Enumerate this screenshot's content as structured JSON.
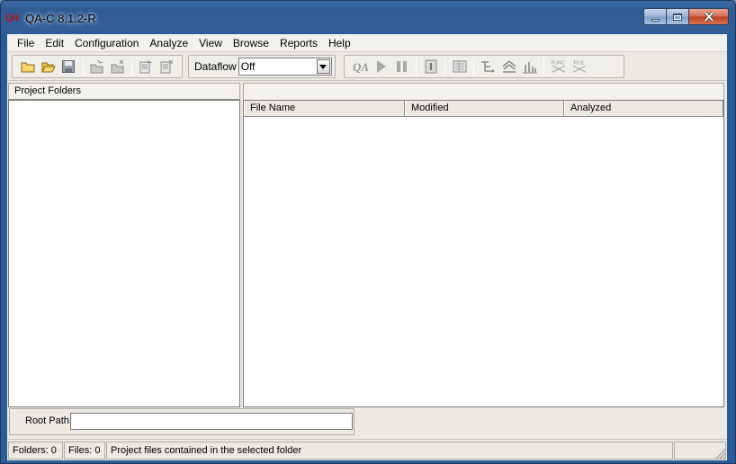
{
  "window": {
    "icon_text": "QA",
    "title": "QA-C 8.1.2-R"
  },
  "menu": {
    "items": [
      "File",
      "Edit",
      "Configuration",
      "Analyze",
      "View",
      "Browse",
      "Reports",
      "Help"
    ]
  },
  "toolbar": {
    "dataflow_label": "Dataflow",
    "dataflow_value": "Off",
    "icons": [
      "new-project-icon",
      "open-project-icon",
      "save-icon",
      "add-folder-icon",
      "remove-folder-icon",
      "add-files-icon",
      "remove-files-icon",
      "qa-analyze-icon",
      "run-icon",
      "pause-icon",
      "info-icon",
      "report-icon",
      "call-tree-icon",
      "hierarchy-icon",
      "metrics-chart-icon",
      "func-relations-icon",
      "file-relations-icon"
    ],
    "func_icon_text": "FUNC",
    "file_icon_text": "FILE"
  },
  "left_pane": {
    "header": "Project Folders"
  },
  "file_table": {
    "columns": [
      "File Name",
      "Modified",
      "Analyzed"
    ]
  },
  "root_path": {
    "label": "Root Path:",
    "value": ""
  },
  "status": {
    "folders": "Folders:  0",
    "files": "Files:  0",
    "message": "Project files contained in the selected folder"
  },
  "colors": {
    "title_bar": "#2f5a92",
    "close_button": "#c0401f",
    "client_bg": "#ece9e3"
  }
}
